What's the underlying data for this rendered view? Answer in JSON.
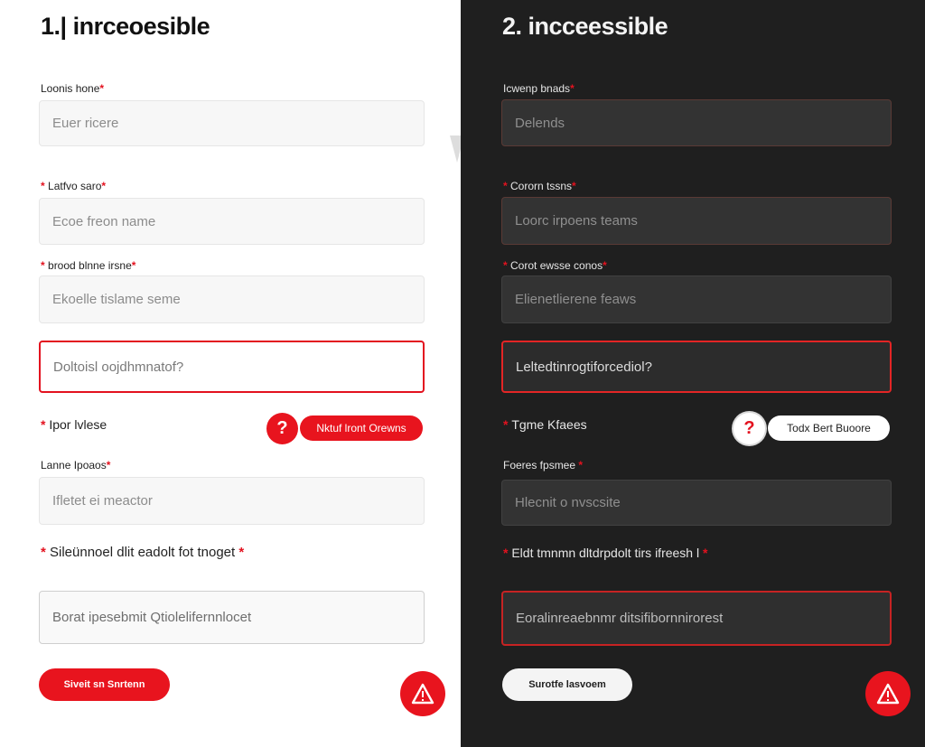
{
  "left": {
    "title": "1.| inrceoesible",
    "fields": [
      {
        "label": "Loonis hone",
        "placeholder": "Euer ricere"
      },
      {
        "label": "Latfvo saro",
        "placeholder": "Ecoe freon name"
      },
      {
        "label": "brood blnne irsne",
        "placeholder": "Ekoelle tislame seme"
      },
      {
        "label": "",
        "placeholder": "Doltoisl oojdhmnatof?"
      },
      {
        "label": "Ipor lvlese",
        "placeholder": ""
      },
      {
        "label": "Lanne Ipoaos",
        "placeholder": "Ifletet ei meactor"
      },
      {
        "label": "Sileünnoel dlit eadolt fot tnoget",
        "placeholder": "Borat ipesebmit Qtiolelifernnlocet"
      }
    ],
    "help_icon": "?",
    "help_pill": "Nktuf lront Orewns",
    "submit_label": "Siveit sn Snrtenn"
  },
  "right": {
    "title": "2.  incceessible",
    "fields": [
      {
        "label": "Icwenp bnads",
        "placeholder": "Delends"
      },
      {
        "label": "Cororn tssns",
        "placeholder": "Loorc irpoens teams"
      },
      {
        "label": "Corot ewsse conos",
        "placeholder": "Elienetlierene feaws"
      },
      {
        "label": "",
        "placeholder": "Leltedtinrogtiforcediol?"
      },
      {
        "label": "Tgme Kfaees",
        "placeholder": ""
      },
      {
        "label": "Foeres fpsmee",
        "placeholder": "Hlecnit o nvscsite"
      },
      {
        "label": "Eldt tmnmn dltdrpdolt tirs ifreesh l",
        "placeholder": "Eoralinreaebnmr ditsifibornnirorest"
      }
    ],
    "help_icon": "?",
    "help_pill": "Todx Bert Buoore",
    "submit_label": "Surotfe lasvoem"
  },
  "colors": {
    "accent": "#e3121f",
    "light_bg": "#ffffff",
    "dark_bg": "#1f1f1f"
  },
  "icons": {
    "help": "question-mark-icon",
    "alert": "warning-triangle-icon"
  }
}
